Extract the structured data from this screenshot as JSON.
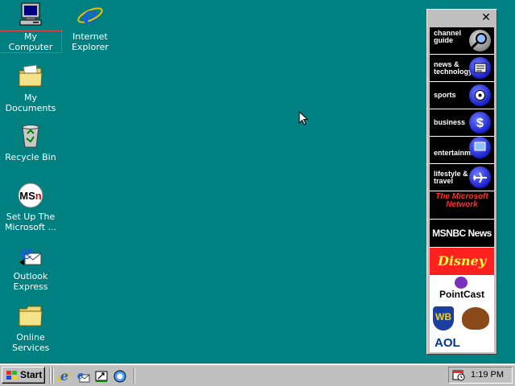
{
  "desktop": {
    "icons": [
      {
        "label": "My Computer",
        "icon": "computer-icon"
      },
      {
        "label": "Internet Explorer",
        "icon": "ie-icon"
      },
      {
        "label": "My Documents",
        "icon": "folder-icon"
      },
      {
        "label": "Recycle Bin",
        "icon": "recycle-bin-icon"
      },
      {
        "label": "Set Up The Microsoft ...",
        "icon": "msn-icon"
      },
      {
        "label": "Outlook Express",
        "icon": "outlook-express-icon"
      },
      {
        "label": "Online Services",
        "icon": "folder-icon"
      }
    ],
    "background_color": "#008080"
  },
  "channel_bar": {
    "close_glyph": "✕",
    "channels": [
      {
        "label": "channel guide",
        "icon": "magnifier-icon"
      },
      {
        "label": "news & technology",
        "icon": "newspaper-icon"
      },
      {
        "label": "sports",
        "icon": "ball-icon"
      },
      {
        "label": "business",
        "icon": "dollar-icon"
      },
      {
        "label": "entertainment",
        "icon": "tv-icon"
      },
      {
        "label": "lifestyle & travel",
        "icon": "airplane-icon"
      }
    ],
    "brands": [
      {
        "label": "The Microsoft Network"
      },
      {
        "label": "MSNBC News"
      },
      {
        "label": "Disney"
      },
      {
        "label": "PointCast"
      },
      {
        "label": "WB"
      },
      {
        "label": "AOL"
      }
    ]
  },
  "taskbar": {
    "start_label": "Start",
    "quick_launch": [
      "ie-icon",
      "outlook-express-icon",
      "show-desktop-icon",
      "channels-icon"
    ],
    "clock": "1:19 PM",
    "tray_icon": "scheduler-icon"
  }
}
